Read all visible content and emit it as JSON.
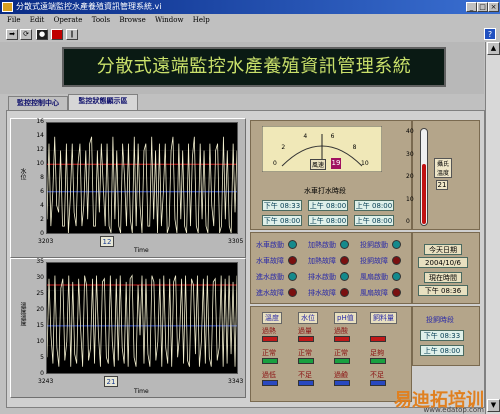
{
  "window": {
    "title": "分散式遠端監控水產養殖資訊管理系統.vi"
  },
  "menu": [
    "File",
    "Edit",
    "Operate",
    "Tools",
    "Browse",
    "Window",
    "Help"
  ],
  "banner": {
    "text": "分散式遠端監控水產養殖資訊管理系統"
  },
  "tabs": [
    {
      "label": "監控控制中心",
      "active": false
    },
    {
      "label": "監控狀態顯示區",
      "active": true
    }
  ],
  "chart1": {
    "ylabel": "水位",
    "xlabel": "Time",
    "yticks": [
      "16",
      "14",
      "12",
      "10",
      "8",
      "6",
      "4",
      "2",
      "0"
    ],
    "x_start": "3203",
    "x_end": "3305",
    "x_value": "12",
    "ylim": [
      0,
      16
    ],
    "threshold_high": 10,
    "threshold_low": 6,
    "values": [
      2,
      13,
      1,
      6,
      14,
      4,
      3,
      12,
      1,
      1,
      13,
      0,
      5,
      13,
      3,
      1,
      10,
      13,
      1,
      4,
      12,
      2,
      13,
      14,
      1,
      1,
      12,
      3,
      13,
      7,
      1,
      13,
      1,
      0,
      14,
      2,
      12,
      1,
      0,
      13,
      8,
      1,
      13,
      2,
      0,
      14,
      1,
      13,
      4,
      0,
      12,
      13,
      1,
      1,
      14,
      2,
      12,
      0,
      13,
      1,
      6,
      13,
      0,
      1,
      12,
      14,
      2,
      0,
      13,
      2,
      12,
      1,
      0,
      13,
      1,
      11,
      14,
      1,
      0,
      13,
      2,
      12,
      1,
      0,
      13,
      4,
      1,
      12,
      13,
      0,
      1,
      14,
      2,
      12,
      1,
      0,
      13,
      3,
      12
    ]
  },
  "chart2": {
    "ylabel": "溫度溫度",
    "xlabel": "Time",
    "yticks": [
      "35",
      "30",
      "25",
      "20",
      "15",
      "10",
      "5",
      "0"
    ],
    "x_start": "3243",
    "x_end": "3343",
    "x_value": "21",
    "ylim": [
      0,
      35
    ],
    "threshold_high": 28,
    "threshold_low": 15,
    "values": [
      5,
      30,
      12,
      3,
      31,
      8,
      2,
      27,
      30,
      4,
      10,
      31,
      2,
      29,
      6,
      3,
      30,
      14,
      2,
      31,
      28,
      4,
      8,
      30,
      3,
      31,
      12,
      2,
      29,
      30,
      5,
      3,
      31,
      10,
      2,
      30,
      4,
      31,
      8,
      3,
      29,
      2,
      30,
      31,
      5,
      2,
      28,
      12,
      31,
      3,
      30,
      6,
      2,
      31,
      29,
      4,
      10,
      30,
      2,
      31,
      8,
      3,
      30,
      2,
      29,
      31,
      5,
      12,
      30,
      3,
      31,
      4,
      2,
      30,
      28,
      6,
      31,
      2,
      10,
      30,
      3,
      31,
      5,
      2,
      29,
      30,
      4,
      8,
      31,
      2,
      30,
      3,
      31,
      6,
      29,
      2,
      31
    ]
  },
  "meter": {
    "scale": [
      "0",
      "2",
      "4",
      "6",
      "8",
      "10"
    ],
    "label": "風速",
    "value": "19",
    "schedule_title": "水車打水時段",
    "times": [
      "下午 08:33",
      "上午 08:00",
      "上午 08:00",
      "下午 08:00",
      "上午 08:00",
      "上午 08:00"
    ]
  },
  "thermometer": {
    "scale": [
      "40",
      "30",
      "20",
      "10",
      "0"
    ],
    "label": "攝氏溫度",
    "value": "21",
    "level": 0.62
  },
  "status": [
    [
      {
        "label": "水車啟動",
        "color": "#148a8c"
      },
      {
        "label": "加熱啟動",
        "color": "#148a8c"
      },
      {
        "label": "投飼啟動",
        "color": "#148a8c"
      }
    ],
    [
      {
        "label": "水車故障",
        "color": "#7a1010"
      },
      {
        "label": "加熱故障",
        "color": "#7a1010"
      },
      {
        "label": "投飼故障",
        "color": "#7a1010"
      }
    ],
    [
      {
        "label": "進水啟動",
        "color": "#148a8c"
      },
      {
        "label": "排水啟動",
        "color": "#148a8c"
      },
      {
        "label": "風扇啟動",
        "color": "#148a8c"
      }
    ],
    [
      {
        "label": "進水故障",
        "color": "#7a1010"
      },
      {
        "label": "排水故障",
        "color": "#7a1010"
      },
      {
        "label": "風扇故障",
        "color": "#7a1010"
      }
    ]
  ],
  "datetime": {
    "date_title": "今天日期",
    "date": "2004/10/6",
    "time_title": "現在時間",
    "time": "下午 08:36"
  },
  "levels": {
    "headers": [
      "溫度",
      "水位",
      "pH值",
      "飼料量"
    ],
    "rows": [
      [
        "過熱",
        "過量",
        "過酸",
        ""
      ],
      [
        "正常",
        "正常",
        "正常",
        "足夠"
      ],
      [
        "過低",
        "不足",
        "過鹼",
        "不足"
      ]
    ]
  },
  "feed": {
    "title": "投飼時段",
    "times": [
      "下午 08:33",
      "上午 08:00"
    ]
  },
  "watermark": {
    "text": "易迪拓培训",
    "url": "www.edatop.com"
  }
}
